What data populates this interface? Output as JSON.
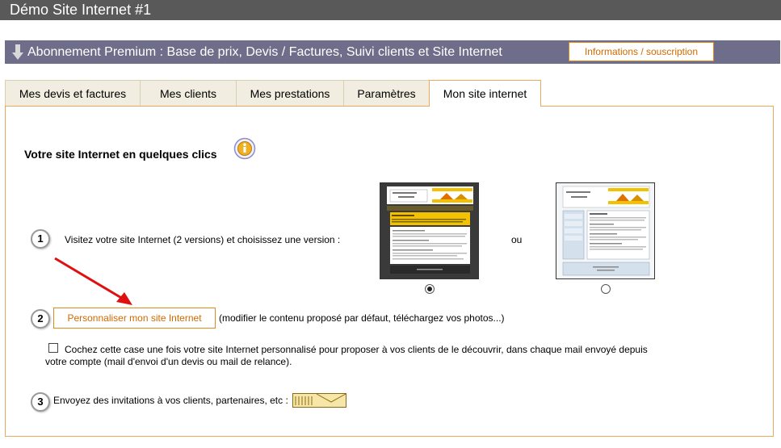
{
  "window": {
    "title": "Démo Site Internet #1"
  },
  "banner": {
    "text": "Abonnement Premium : Base de prix, Devis / Factures, Suivi clients et Site Internet",
    "button_label": "Informations / souscription"
  },
  "tabs": [
    {
      "label": "Mes devis et factures",
      "active": false
    },
    {
      "label": "Mes clients",
      "active": false
    },
    {
      "label": "Mes prestations",
      "active": false
    },
    {
      "label": "Paramètres",
      "active": false
    },
    {
      "label": "Mon site internet",
      "active": true
    }
  ],
  "main": {
    "heading": "Votre site Internet en quelques clics",
    "step1": {
      "number": "1",
      "text": "Visitez votre site Internet (2 versions) et choisissez une version :",
      "or": "ou",
      "selected_version": 1
    },
    "step2": {
      "number": "2",
      "button_label": "Personnaliser mon site Internet",
      "hint": "(modifier le contenu proposé par défaut, téléchargez vos photos...)"
    },
    "checkbox": {
      "checked": false,
      "line1": "Cochez cette case une fois votre site Internet personnalisé pour proposer à vos clients de le découvrir, dans chaque mail envoyé depuis",
      "line2": "votre compte (mail d'envoi d'un devis ou mail de relance)."
    },
    "step3": {
      "number": "3",
      "text": "Envoyez des invitations à vos clients, partenaires, etc :"
    }
  },
  "colors": {
    "accent": "#e08a1e",
    "titlebar": "#595959",
    "banner": "#6e6e8a"
  },
  "icons": [
    "down-arrow-icon",
    "info-icon",
    "envelope-icon",
    "red-arrow-icon"
  ]
}
